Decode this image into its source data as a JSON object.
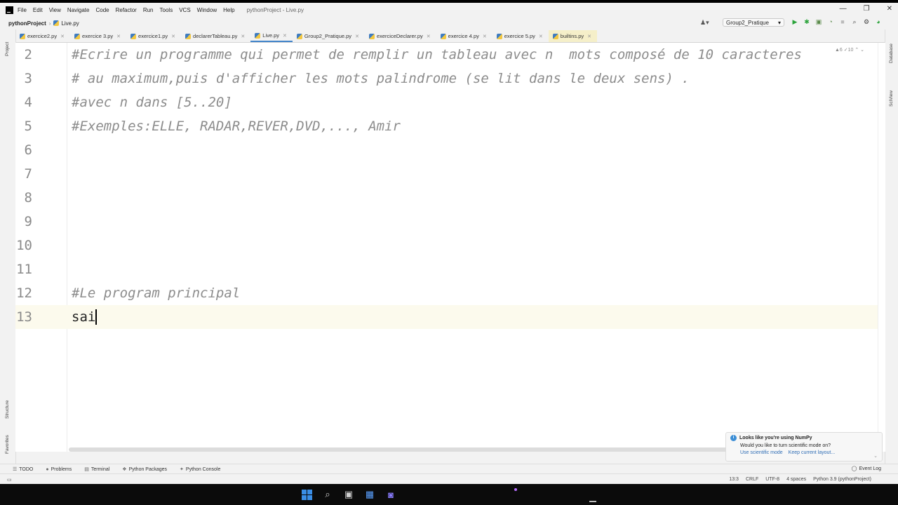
{
  "window": {
    "title": "pythonProject - Live.py",
    "menu": [
      "File",
      "Edit",
      "View",
      "Navigate",
      "Code",
      "Refactor",
      "Run",
      "Tools",
      "VCS",
      "Window",
      "Help"
    ],
    "controls": [
      "—",
      "❐",
      "✕"
    ]
  },
  "nav": {
    "project": "pythonProject",
    "file": "Live.py",
    "run_config": "Group2_Pratique",
    "run_config_caret": "▾"
  },
  "tabs": [
    {
      "label": "exercice2.py"
    },
    {
      "label": "exercice 3.py"
    },
    {
      "label": "exercice1.py"
    },
    {
      "label": "declarerTableau.py"
    },
    {
      "label": "Live.py",
      "active": true
    },
    {
      "label": "Group2_Pratique.py"
    },
    {
      "label": "exerciceDeclarer.py"
    },
    {
      "label": "exercice 4.py"
    },
    {
      "label": "exercice 5.py"
    },
    {
      "label": "builtins.py"
    }
  ],
  "editor": {
    "inspection": "▲6  ✓10  ⌃ ⌄",
    "lines": [
      {
        "num": "2",
        "text": "#Ecrire un programme qui permet de remplir un tableau avec n  mots composé de 10 caracteres",
        "kind": "comment"
      },
      {
        "num": "3",
        "text": "# au maximum,puis d'afficher les mots palindrome (se lit dans le deux sens) .",
        "kind": "comment"
      },
      {
        "num": "4",
        "text": "#avec n dans [5..20]",
        "kind": "comment"
      },
      {
        "num": "5",
        "text": "#Exemples:ELLE, RADAR,REVER,DVD,..., Amir",
        "kind": "comment"
      },
      {
        "num": "6",
        "text": "",
        "kind": "plain"
      },
      {
        "num": "7",
        "text": "",
        "kind": "plain"
      },
      {
        "num": "8",
        "text": "",
        "kind": "plain"
      },
      {
        "num": "9",
        "text": "",
        "kind": "plain"
      },
      {
        "num": "10",
        "text": "",
        "kind": "plain"
      },
      {
        "num": "11",
        "text": "",
        "kind": "plain"
      },
      {
        "num": "12",
        "text": "#Le program principal",
        "kind": "comment"
      },
      {
        "num": "13",
        "text": "sai",
        "kind": "plain",
        "current": true
      }
    ]
  },
  "side": {
    "left_top": "Project",
    "left_structure": "Structure",
    "left_favorites": "Favorites",
    "right_db": "Database",
    "right_sciview": "SciView"
  },
  "bottom_tabs": [
    "TODO",
    "Problems",
    "Terminal",
    "Python Packages",
    "Python Console"
  ],
  "event_log": "Event Log",
  "status": {
    "position": "13:3",
    "line_sep": "CRLF",
    "encoding": "UTF-8",
    "indent": "4 spaces",
    "interpreter": "Python 3.9 (pythonProject)"
  },
  "notification": {
    "title": "Looks like you're using NumPy",
    "body": "Would you like to turn scientific mode on?",
    "link1": "Use scientific mode",
    "link2": "Keep current layout..."
  }
}
